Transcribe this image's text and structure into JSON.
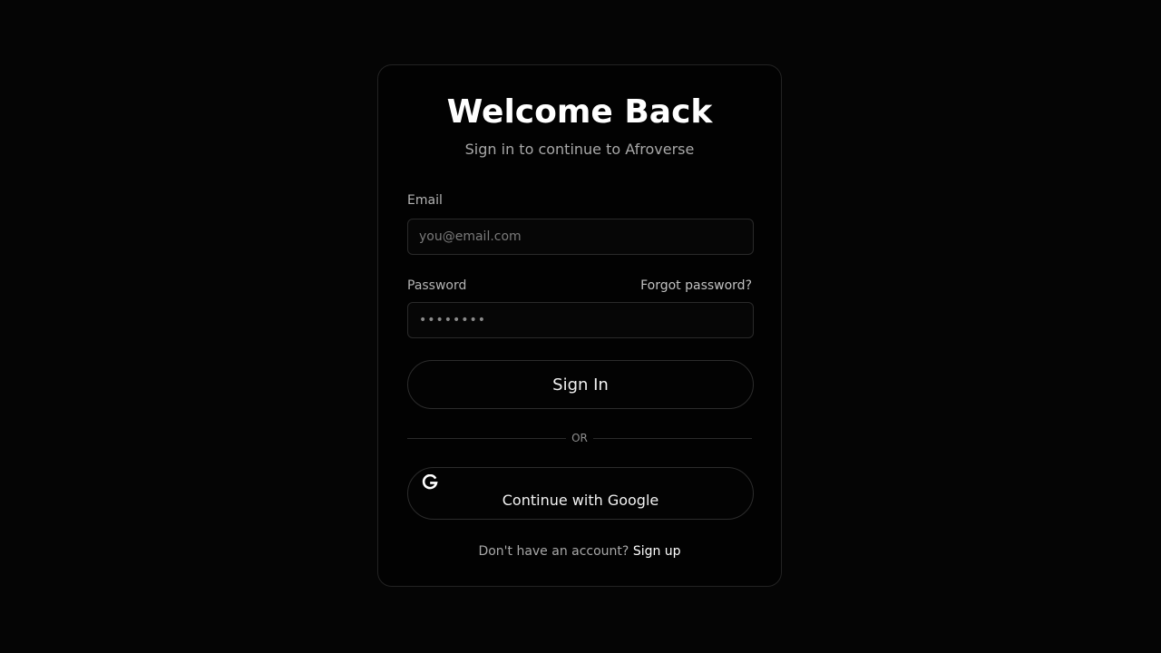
{
  "login": {
    "title": "Welcome Back",
    "subtitle": "Sign in to continue to Afroverse",
    "email": {
      "label": "Email",
      "placeholder": "you@email.com",
      "value": ""
    },
    "password": {
      "label": "Password",
      "forgot_label": "Forgot password?",
      "placeholder": "••••••••"
    },
    "signin_label": "Sign In",
    "divider_text": "OR",
    "google": {
      "label": "Continue with Google",
      "icon": "google-icon"
    },
    "footer": {
      "prompt": "Don't have an account?",
      "signup_label": "Sign up"
    }
  },
  "colors": {
    "background": "#050505",
    "card": "#020202",
    "border": "#232323",
    "text": "#ffffff",
    "muted_text": "#a8a8a8"
  }
}
